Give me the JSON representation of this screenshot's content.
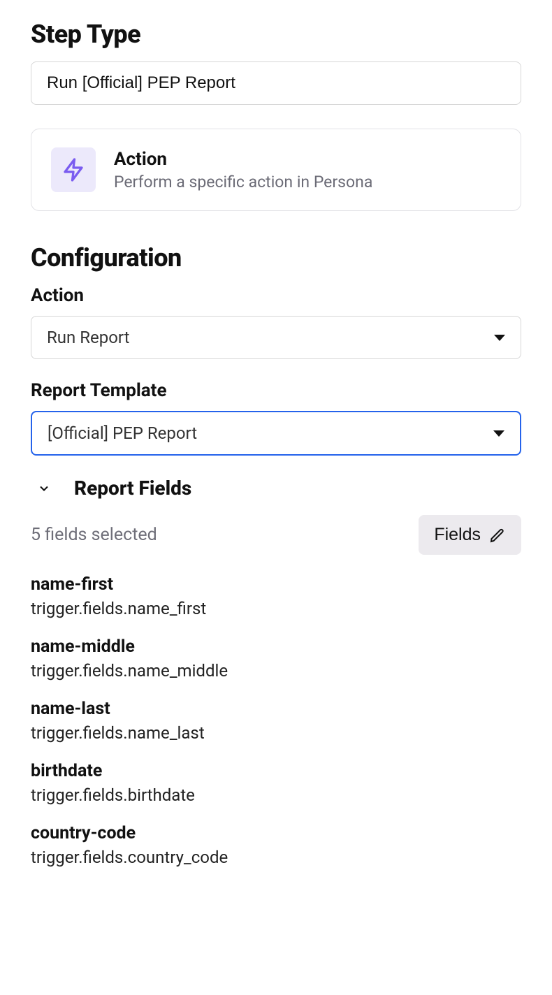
{
  "step_type": {
    "heading": "Step Type",
    "value": "Run [Official] PEP Report"
  },
  "action_card": {
    "title": "Action",
    "subtitle": "Perform a specific action in Persona",
    "icon": "lightning-bolt-icon"
  },
  "configuration": {
    "heading": "Configuration",
    "action": {
      "label": "Action",
      "value": "Run Report"
    },
    "report_template": {
      "label": "Report Template",
      "value": "[Official] PEP Report"
    },
    "report_fields": {
      "title": "Report Fields",
      "selected_text": "5 fields selected",
      "button_label": "Fields",
      "items": [
        {
          "name": "name-first",
          "path": "trigger.fields.name_first"
        },
        {
          "name": "name-middle",
          "path": "trigger.fields.name_middle"
        },
        {
          "name": "name-last",
          "path": "trigger.fields.name_last"
        },
        {
          "name": "birthdate",
          "path": "trigger.fields.birthdate"
        },
        {
          "name": "country-code",
          "path": "trigger.fields.country_code"
        }
      ]
    }
  }
}
